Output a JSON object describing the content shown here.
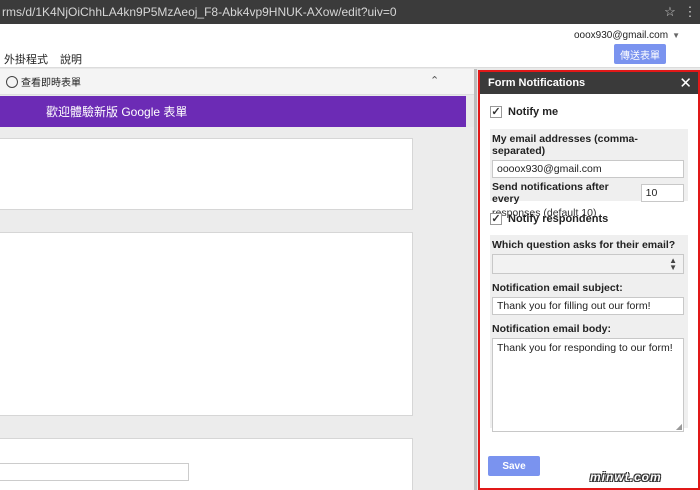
{
  "browser": {
    "url": "rms/d/1K4NjOiChhLA4kn9P5MzAeoj_F8-Abk4vp9HNUK-AXow/edit?uiv=0",
    "star_icon": "star-icon",
    "menu_icon": "kebab-menu-icon"
  },
  "app": {
    "menu": [
      "外掛程式",
      "說明"
    ],
    "account_email": "ooox930@gmail.com",
    "send_label": "傳送表單"
  },
  "editor": {
    "view_live_label": "查看即時表單",
    "banner_text": "歡迎體驗新版 Google 表單"
  },
  "panel": {
    "title": "Form Notifications",
    "notify_me_label": "Notify me",
    "notify_me_checked": true,
    "email_label": "My email addresses (comma-separated)",
    "email_value": "oooox930@gmail.com",
    "after_every_label": "Send notifications after every",
    "after_every_value": "10",
    "responses_hint": "responses (default 10)",
    "notify_respondents_label": "Notify respondents",
    "notify_respondents_checked": true,
    "which_question_label": "Which question asks for their email?",
    "which_question_value": "",
    "subject_label": "Notification email subject:",
    "subject_value": "Thank you for filling out our form!",
    "body_label": "Notification email body:",
    "body_value": "Thank you for responding to our form!",
    "save_label": "Save"
  },
  "watermark": "minwt.com",
  "colors": {
    "accent_button": "#7a93ef",
    "banner_purple": "#6c2bb5",
    "highlight_border": "#e11818",
    "panel_header": "#3a3a3a"
  }
}
